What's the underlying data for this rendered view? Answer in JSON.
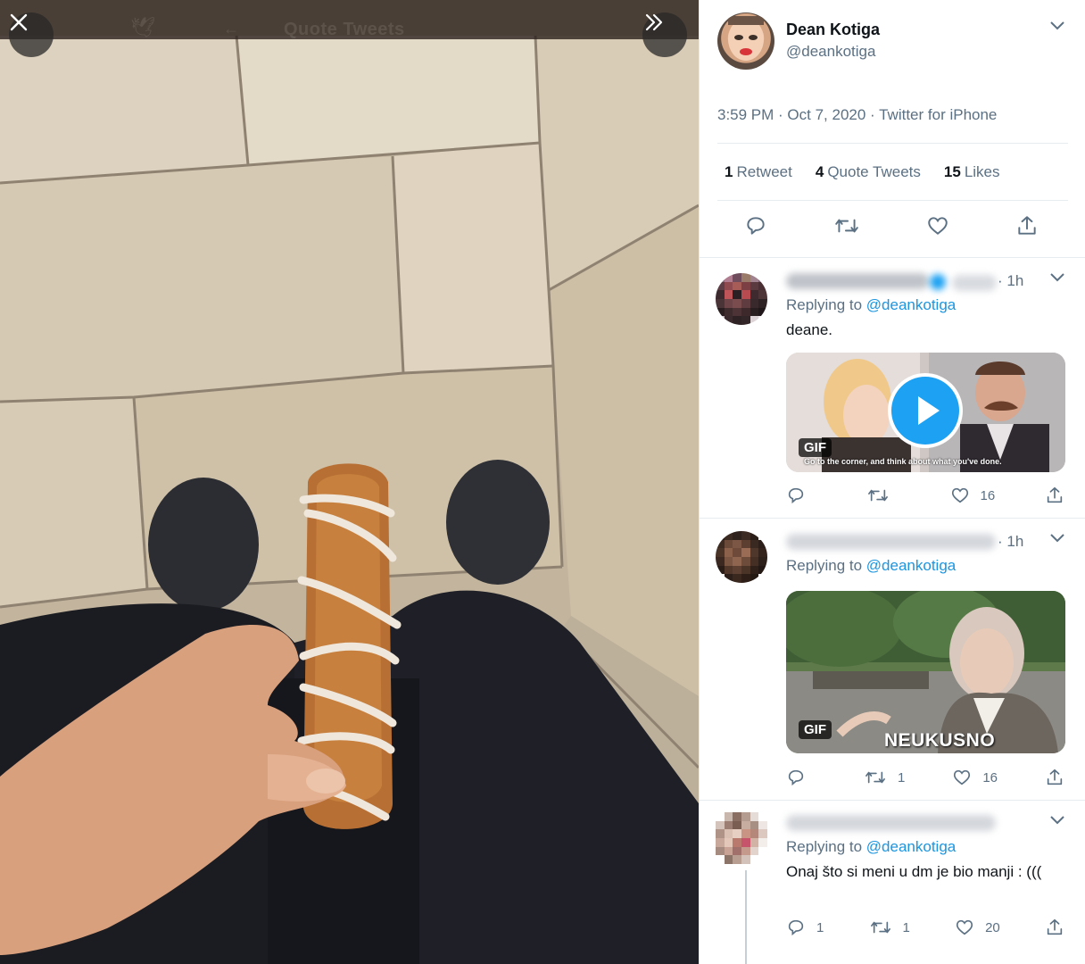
{
  "viewer": {
    "close_icon": "close-icon",
    "expand_icon": "double-chevron-right-icon",
    "ghost_title": "Quote Tweets"
  },
  "tweet": {
    "author_name": "Dean Kotiga",
    "author_handle": "@deankotiga",
    "timestamp": "3:59 PM · Oct 7, 2020 · Twitter for iPhone",
    "stats": {
      "retweets_count": "1",
      "retweets_label": "Retweet",
      "quotes_count": "4",
      "quotes_label": "Quote Tweets",
      "likes_count": "15",
      "likes_label": "Likes"
    },
    "action_icons": [
      "reply-icon",
      "retweet-icon",
      "like-icon",
      "share-icon"
    ]
  },
  "replies": [
    {
      "time": "· 1h",
      "replying_prefix": "Replying to",
      "replying_handle": "@deankotiga",
      "text": "deane.",
      "media": {
        "badge": "GIF",
        "caption": "Go to the corner, and think about what you've done."
      },
      "replies_count": "",
      "retweets_count": "",
      "likes_count": "16"
    },
    {
      "time": "· 1h",
      "replying_prefix": "Replying to",
      "replying_handle": "@deankotiga",
      "text": "",
      "media": {
        "badge": "GIF",
        "caption": "NEUKUSNO"
      },
      "replies_count": "",
      "retweets_count": "1",
      "likes_count": "16"
    },
    {
      "time": "",
      "replying_prefix": "Replying to",
      "replying_handle": "@deankotiga",
      "text": "Onaj što si meni u dm je bio manji : (((",
      "replies_count": "1",
      "retweets_count": "1",
      "likes_count": "20"
    }
  ],
  "colors": {
    "link": "#1b95e0",
    "muted": "#5b7083",
    "text": "#0f1419",
    "play": "#1da1f2"
  }
}
